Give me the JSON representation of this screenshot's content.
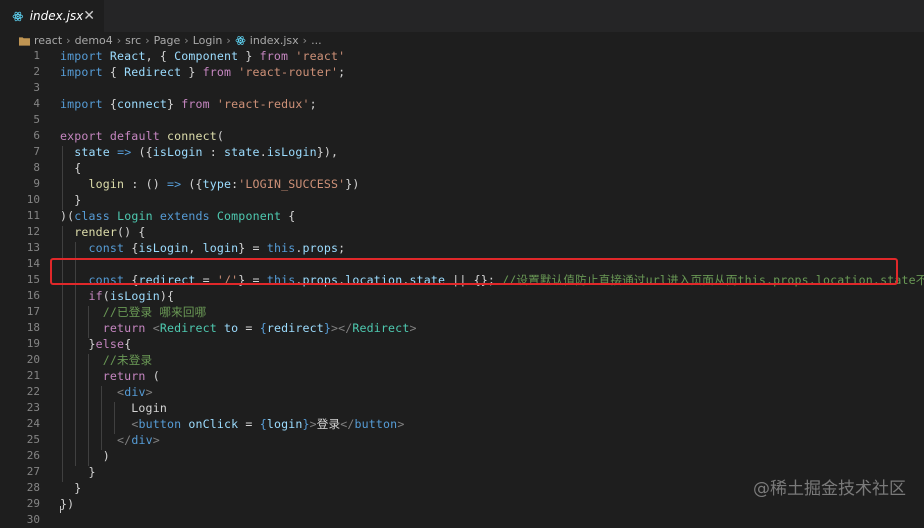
{
  "tab": {
    "filename": "index.jsx",
    "close_glyph": "✕",
    "icon": "react-icon"
  },
  "breadcrumb": {
    "items": [
      "react",
      "demo4",
      "src",
      "Page",
      "Login",
      "index.jsx",
      "..."
    ],
    "separator": "›"
  },
  "editor": {
    "highlighted_line": 15,
    "lines": [
      {
        "n": "1",
        "t": [
          [
            "kw",
            "import"
          ],
          [
            "plain",
            " "
          ],
          [
            "var",
            "React"
          ],
          [
            "plain",
            ", { "
          ],
          [
            "var",
            "Component"
          ],
          [
            "plain",
            " } "
          ],
          [
            "ctl",
            "from"
          ],
          [
            "plain",
            " "
          ],
          [
            "str",
            "'react'"
          ]
        ]
      },
      {
        "n": "2",
        "t": [
          [
            "kw",
            "import"
          ],
          [
            "plain",
            " { "
          ],
          [
            "var",
            "Redirect"
          ],
          [
            "plain",
            " } "
          ],
          [
            "ctl",
            "from"
          ],
          [
            "plain",
            " "
          ],
          [
            "str",
            "'react-router'"
          ],
          [
            "plain",
            ";"
          ]
        ]
      },
      {
        "n": "3",
        "t": []
      },
      {
        "n": "4",
        "t": [
          [
            "kw",
            "import"
          ],
          [
            "plain",
            " {"
          ],
          [
            "var",
            "connect"
          ],
          [
            "plain",
            "} "
          ],
          [
            "ctl",
            "from"
          ],
          [
            "plain",
            " "
          ],
          [
            "str",
            "'react-redux'"
          ],
          [
            "plain",
            ";"
          ]
        ]
      },
      {
        "n": "5",
        "t": []
      },
      {
        "n": "6",
        "t": [
          [
            "ctl",
            "export"
          ],
          [
            "plain",
            " "
          ],
          [
            "ctl",
            "default"
          ],
          [
            "plain",
            " "
          ],
          [
            "fn",
            "connect"
          ],
          [
            "plain",
            "("
          ]
        ]
      },
      {
        "n": "7",
        "t": [
          [
            "plain",
            "  "
          ],
          [
            "var",
            "state"
          ],
          [
            "plain",
            " "
          ],
          [
            "kw",
            "=>"
          ],
          [
            "plain",
            " ({"
          ],
          [
            "var",
            "isLogin"
          ],
          [
            "plain",
            " : "
          ],
          [
            "var",
            "state"
          ],
          [
            "plain",
            "."
          ],
          [
            "var",
            "isLogin"
          ],
          [
            "plain",
            "}),"
          ]
        ]
      },
      {
        "n": "8",
        "t": [
          [
            "plain",
            "  {"
          ]
        ]
      },
      {
        "n": "9",
        "t": [
          [
            "plain",
            "    "
          ],
          [
            "fn",
            "login"
          ],
          [
            "plain",
            " : () "
          ],
          [
            "kw",
            "=>"
          ],
          [
            "plain",
            " ({"
          ],
          [
            "var",
            "type"
          ],
          [
            "plain",
            ":"
          ],
          [
            "str",
            "'LOGIN_SUCCESS'"
          ],
          [
            "plain",
            "})"
          ]
        ]
      },
      {
        "n": "10",
        "t": [
          [
            "plain",
            "  }"
          ]
        ]
      },
      {
        "n": "11",
        "t": [
          [
            "plain",
            ")("
          ],
          [
            "kw",
            "class"
          ],
          [
            "plain",
            " "
          ],
          [
            "cls",
            "Login"
          ],
          [
            "plain",
            " "
          ],
          [
            "kw",
            "extends"
          ],
          [
            "plain",
            " "
          ],
          [
            "cls",
            "Component"
          ],
          [
            "plain",
            " {"
          ]
        ]
      },
      {
        "n": "12",
        "t": [
          [
            "plain",
            "  "
          ],
          [
            "fn",
            "render"
          ],
          [
            "plain",
            "() {"
          ]
        ]
      },
      {
        "n": "13",
        "t": [
          [
            "plain",
            "    "
          ],
          [
            "kw",
            "const"
          ],
          [
            "plain",
            " {"
          ],
          [
            "var",
            "isLogin"
          ],
          [
            "plain",
            ", "
          ],
          [
            "var",
            "login"
          ],
          [
            "plain",
            "} = "
          ],
          [
            "kw",
            "this"
          ],
          [
            "plain",
            "."
          ],
          [
            "var",
            "props"
          ],
          [
            "plain",
            ";"
          ]
        ]
      },
      {
        "n": "14",
        "t": []
      },
      {
        "n": "15",
        "t": [
          [
            "plain",
            "    "
          ],
          [
            "kw",
            "const"
          ],
          [
            "plain",
            " {"
          ],
          [
            "var",
            "redirect"
          ],
          [
            "plain",
            " = "
          ],
          [
            "str",
            "'/'"
          ],
          [
            "plain",
            "} = "
          ],
          [
            "kw",
            "this"
          ],
          [
            "plain",
            "."
          ],
          [
            "var",
            "props"
          ],
          [
            "plain",
            "."
          ],
          [
            "var",
            "location"
          ],
          [
            "plain",
            "."
          ],
          [
            "var",
            "state"
          ],
          [
            "plain",
            " || {}; "
          ],
          [
            "cmt",
            "//设置默认值防止直接通过url进入页面从而this.props.location.state不存在"
          ]
        ]
      },
      {
        "n": "16",
        "t": [
          [
            "plain",
            "    "
          ],
          [
            "ctl",
            "if"
          ],
          [
            "plain",
            "("
          ],
          [
            "var",
            "isLogin"
          ],
          [
            "plain",
            "){"
          ]
        ]
      },
      {
        "n": "17",
        "t": [
          [
            "plain",
            "      "
          ],
          [
            "cmt",
            "//已登录 哪来回哪"
          ]
        ]
      },
      {
        "n": "18",
        "t": [
          [
            "plain",
            "      "
          ],
          [
            "ctl",
            "return"
          ],
          [
            "plain",
            " "
          ],
          [
            "punct",
            "<"
          ],
          [
            "cls",
            "Redirect"
          ],
          [
            "plain",
            " "
          ],
          [
            "var",
            "to"
          ],
          [
            "plain",
            " = "
          ],
          [
            "kw",
            "{"
          ],
          [
            "var",
            "redirect"
          ],
          [
            "kw",
            "}"
          ],
          [
            "punct",
            "></"
          ],
          [
            "cls",
            "Redirect"
          ],
          [
            "punct",
            ">"
          ]
        ]
      },
      {
        "n": "19",
        "t": [
          [
            "plain",
            "    }"
          ],
          [
            "ctl",
            "else"
          ],
          [
            "plain",
            "{"
          ]
        ]
      },
      {
        "n": "20",
        "t": [
          [
            "plain",
            "      "
          ],
          [
            "cmt",
            "//未登录"
          ]
        ]
      },
      {
        "n": "21",
        "t": [
          [
            "plain",
            "      "
          ],
          [
            "ctl",
            "return"
          ],
          [
            "plain",
            " ("
          ]
        ]
      },
      {
        "n": "22",
        "t": [
          [
            "plain",
            "        "
          ],
          [
            "punct",
            "<"
          ],
          [
            "tag",
            "div"
          ],
          [
            "punct",
            ">"
          ]
        ]
      },
      {
        "n": "23",
        "t": [
          [
            "plain",
            "          Login"
          ]
        ]
      },
      {
        "n": "24",
        "t": [
          [
            "plain",
            "          "
          ],
          [
            "punct",
            "<"
          ],
          [
            "tag",
            "button"
          ],
          [
            "plain",
            " "
          ],
          [
            "var",
            "onClick"
          ],
          [
            "plain",
            " = "
          ],
          [
            "kw",
            "{"
          ],
          [
            "var",
            "login"
          ],
          [
            "kw",
            "}"
          ],
          [
            "punct",
            ">"
          ],
          [
            "plain",
            "登录"
          ],
          [
            "punct",
            "</"
          ],
          [
            "tag",
            "button"
          ],
          [
            "punct",
            ">"
          ]
        ]
      },
      {
        "n": "25",
        "t": [
          [
            "plain",
            "        "
          ],
          [
            "punct",
            "</"
          ],
          [
            "tag",
            "div"
          ],
          [
            "punct",
            ">"
          ]
        ]
      },
      {
        "n": "26",
        "t": [
          [
            "plain",
            "      )"
          ]
        ]
      },
      {
        "n": "27",
        "t": [
          [
            "plain",
            "    }"
          ]
        ]
      },
      {
        "n": "28",
        "t": [
          [
            "plain",
            "  }"
          ]
        ]
      },
      {
        "n": "29",
        "t": [
          [
            "plain",
            "})"
          ]
        ]
      },
      {
        "n": "30",
        "t": []
      }
    ]
  },
  "watermark": "@稀土掘金技术社区",
  "colors": {
    "highlight_border": "#e0282a",
    "editor_bg": "#1e1e1e",
    "tab_bg": "#252526"
  }
}
